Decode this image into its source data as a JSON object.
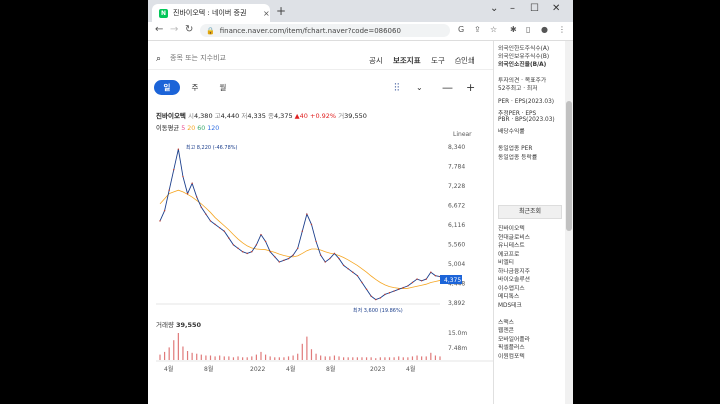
{
  "browser": {
    "tab_title": "진바이오텍 : 네이버 증권",
    "tab_close": "×",
    "new_tab": "+",
    "url": "finance.naver.com/item/fchart.naver?code=086060",
    "favicon": "N",
    "win_min": "–",
    "win_max": "☐",
    "win_close": "✕",
    "win_chevron": "⌄"
  },
  "header": {
    "search_placeholder": "종목 또는 지수비교",
    "links": [
      "공시",
      "보조지표",
      "도구",
      "인쇄"
    ]
  },
  "period_tabs": [
    "일",
    "주",
    "월"
  ],
  "stock": {
    "name": "진바이오텍",
    "open_label": "시",
    "open": "4,380",
    "high_label": "고",
    "high": "4,440",
    "low_label": "저",
    "low": "4,335",
    "close_label": "종",
    "close": "4,375",
    "change": "▲40 +0.92%",
    "volume_label": "거",
    "volume": "39,550",
    "ma_label": "이동평균",
    "ma": [
      "5",
      "20",
      "60",
      "120"
    ],
    "ma_colors": [
      "#e94b8f",
      "#f5a623",
      "#3aa96b",
      "#2f6de1"
    ]
  },
  "chart": {
    "scale_label": "Linear",
    "y_ticks": [
      "8,340",
      "7,784",
      "7,228",
      "6,672",
      "6,116",
      "5,560",
      "5,004",
      "4,448",
      "3,892"
    ],
    "current_price": "4,375",
    "high_note": "최고 8,220 (-46.78%)",
    "low_note": "최저 3,600 (19.86%)",
    "volume_title": "거래량",
    "volume_value": "39,550",
    "vol_ticks": [
      "15.0m",
      "7.48m"
    ],
    "x_ticks": [
      "4월",
      "8월",
      "2022",
      "4월",
      "8월",
      "2023",
      "4월"
    ]
  },
  "chart_data": {
    "type": "line",
    "title": "",
    "ylim": [
      3600,
      8340
    ],
    "close": [
      6000,
      6300,
      6900,
      7500,
      8100,
      7300,
      6800,
      7100,
      6700,
      6400,
      6200,
      6000,
      5900,
      5800,
      5700,
      5500,
      5300,
      5200,
      5100,
      5050,
      5100,
      5300,
      5600,
      5400,
      5100,
      4950,
      4800,
      4850,
      4900,
      5000,
      5200,
      5700,
      6200,
      5900,
      5400,
      5000,
      4800,
      4900,
      5050,
      4900,
      4700,
      4600,
      4500,
      4400,
      4200,
      4000,
      3800,
      3700,
      3750,
      3850,
      3900,
      3950,
      4000,
      4050,
      4100,
      4200,
      4300,
      4250,
      4300,
      4500,
      4400,
      4375
    ],
    "ma": [
      6500,
      6650,
      6800,
      6850,
      6900,
      6850,
      6780,
      6700,
      6600,
      6500,
      6380,
      6250,
      6100,
      5980,
      5860,
      5740,
      5600,
      5470,
      5360,
      5270,
      5210,
      5180,
      5170,
      5160,
      5120,
      5080,
      5030,
      4990,
      4960,
      4950,
      4980,
      5050,
      5130,
      5180,
      5180,
      5150,
      5100,
      5060,
      5030,
      4990,
      4930,
      4860,
      4780,
      4700,
      4600,
      4500,
      4390,
      4290,
      4200,
      4130,
      4080,
      4050,
      4030,
      4020,
      4030,
      4060,
      4090,
      4120,
      4150,
      4200,
      4230,
      4260
    ],
    "volume": [
      0.6,
      0.9,
      1.4,
      2.2,
      3.0,
      1.5,
      1.0,
      0.8,
      0.7,
      0.6,
      0.5,
      0.5,
      0.4,
      0.5,
      0.4,
      0.4,
      0.3,
      0.4,
      0.3,
      0.3,
      0.4,
      0.6,
      0.9,
      0.6,
      0.4,
      0.3,
      0.3,
      0.3,
      0.4,
      0.5,
      0.7,
      1.8,
      2.6,
      1.2,
      0.7,
      0.5,
      0.4,
      0.4,
      0.5,
      0.4,
      0.3,
      0.3,
      0.3,
      0.3,
      0.3,
      0.3,
      0.3,
      0.2,
      0.3,
      0.3,
      0.3,
      0.3,
      0.4,
      0.3,
      0.3,
      0.4,
      0.5,
      0.4,
      0.4,
      0.8,
      0.5,
      0.4
    ]
  },
  "sidebar": {
    "top_items": [
      "외국인한도주식수(A)",
      "외국인보유주식수(B)",
      "외국인소진율(B/A)",
      "투자의견 · 목표주가",
      "52주최고 · 최저"
    ],
    "mid_items": [
      "PER · EPS(2023.03)",
      "추정PER · EPS",
      "PBR · BPS(2023.03)",
      "배당수익률"
    ],
    "sector_items": [
      "동일업종 PER",
      "동일업종 등락률"
    ],
    "recent_title": "최근조회",
    "recent_items": [
      "진바이오텍",
      "현대글로비스",
      "유니테스트",
      "에코프로",
      "비엘티",
      "하나금융지주",
      "바이오솔루션",
      "이수앱지스",
      "메디톡스",
      "MDS테크",
      "",
      "스맥스",
      "웹젠콘",
      "모바일어플라",
      "픽셀플러스",
      "이원컴포텍"
    ]
  }
}
